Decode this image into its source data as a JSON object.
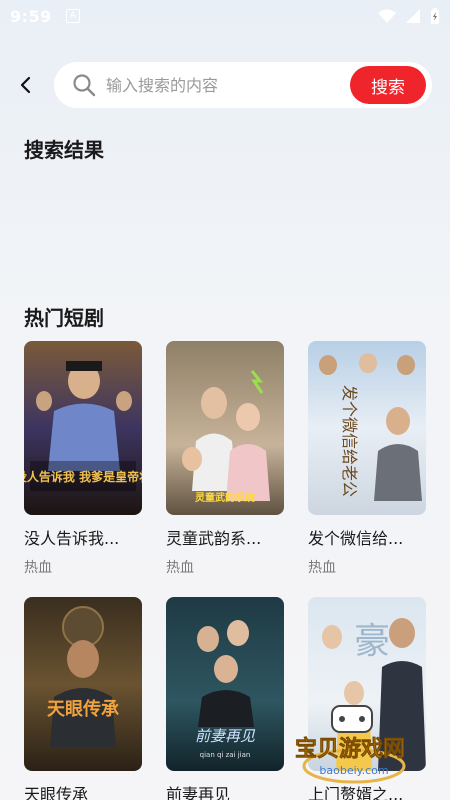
{
  "status_bar": {
    "time": "9:59",
    "a_icon": "A"
  },
  "search": {
    "placeholder": "输入搜索的内容",
    "value": "",
    "button_label": "搜索"
  },
  "results_section": {
    "title": "搜索结果"
  },
  "hot_section": {
    "title": "热门短剧",
    "dramas": [
      {
        "title": "没人告诉我...",
        "tag": "热血",
        "poster_text": "没人告诉我 我爹是皇帝将"
      },
      {
        "title": "灵童武韵系...",
        "tag": "热血",
        "poster_text": "灵童武韵系统"
      },
      {
        "title": "发个微信给...",
        "tag": "热血",
        "poster_text": "发个微信给老公"
      },
      {
        "title": "天眼传承",
        "tag": "",
        "poster_text": "天眼传承"
      },
      {
        "title": "前妻再见",
        "tag": "",
        "poster_text": "前妻再见",
        "poster_subtext": "qian qi zai jian"
      },
      {
        "title": "上门赘婿之...",
        "tag": "",
        "poster_text": "豪"
      }
    ]
  },
  "watermark": {
    "text": "宝贝游戏网",
    "url": "baobeiy.com"
  }
}
